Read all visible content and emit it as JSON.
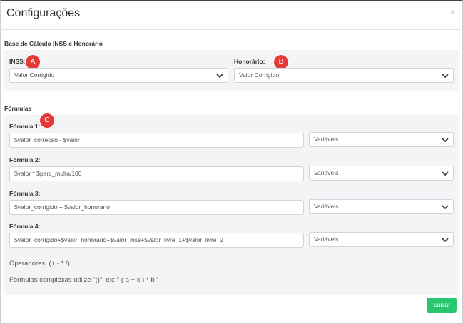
{
  "modal": {
    "title": "Configurações",
    "close_glyph": "×"
  },
  "base_section": {
    "title": "Base de Cálculo INSS e Honorário",
    "inss": {
      "label": "INSS:",
      "selected": "Valor Corrigido",
      "badge": "A"
    },
    "honorario": {
      "label": "Honorário:",
      "selected": "Valor Corrigido",
      "badge": "B"
    }
  },
  "formulas_section": {
    "title": "Fórmulas",
    "badge": "C",
    "formulas": [
      {
        "label": "Fórmula 1:",
        "value": "$valor_correcao - $valor",
        "variables": "Variáveis"
      },
      {
        "label": "Fórmula 2:",
        "value": "$valor * $perc_multa/100",
        "variables": "Variáveis"
      },
      {
        "label": "Fórmula 3:",
        "value": "$valor_corrigido + $valor_honorario",
        "variables": "Variáveis"
      },
      {
        "label": "Fórmula 4:",
        "value": "$valor_corrigido+$valor_honorario+$valor_inss+$valor_livre_1+$valor_livre_2",
        "variables": "Variáveis"
      }
    ],
    "operators_note": "Operadores: (+ - * /)",
    "complex_note": "Fórmulas complexas utilize \"()\", ex: \" ( a + c ) * b \""
  },
  "footer": {
    "save_label": "Salvar"
  },
  "colors": {
    "badge": "#e53935",
    "save_button": "#28c76f",
    "panel_bg": "#f3f4f6"
  },
  "icons": [
    "close-icon",
    "chevron-down-icon"
  ]
}
